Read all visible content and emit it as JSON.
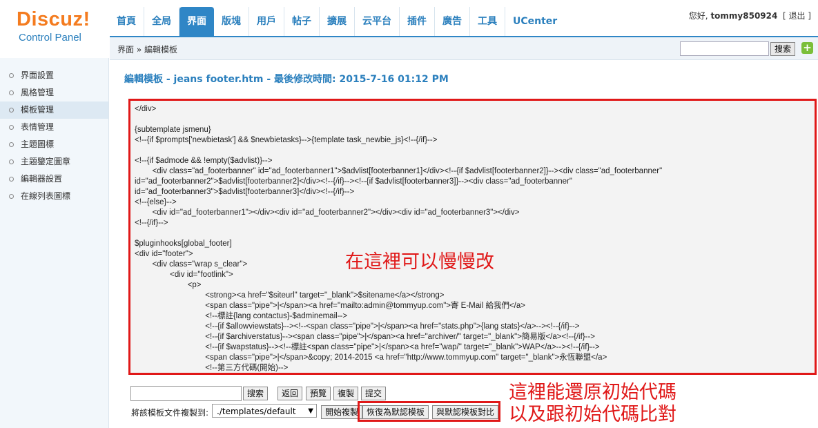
{
  "logo": {
    "main": "Discuz!",
    "sub": "Control Panel"
  },
  "nav": [
    {
      "label": "首頁",
      "active": false
    },
    {
      "label": "全局",
      "active": false
    },
    {
      "label": "界面",
      "active": true
    },
    {
      "label": "版塊",
      "active": false
    },
    {
      "label": "用戶",
      "active": false
    },
    {
      "label": "帖子",
      "active": false
    },
    {
      "label": "擴展",
      "active": false
    },
    {
      "label": "云平台",
      "active": false
    },
    {
      "label": "插件",
      "active": false
    },
    {
      "label": "廣告",
      "active": false
    },
    {
      "label": "工具",
      "active": false
    },
    {
      "label": "UCenter",
      "active": false
    }
  ],
  "user": {
    "greeting": "您好,",
    "name": "tommy850924",
    "logout": "[ 退出 ]"
  },
  "breadcrumb": "界面 » 編輯模板",
  "top_search": {
    "button": "搜索",
    "add": "+"
  },
  "sidebar": [
    {
      "label": "界面設置",
      "active": false
    },
    {
      "label": "風格管理",
      "active": false
    },
    {
      "label": "模板管理",
      "active": true
    },
    {
      "label": "表情管理",
      "active": false
    },
    {
      "label": "主題圖標",
      "active": false
    },
    {
      "label": "主題鑒定圖章",
      "active": false
    },
    {
      "label": "編輯器設置",
      "active": false
    },
    {
      "label": "在線列表圖標",
      "active": false
    }
  ],
  "page_title": "編輯模板 - jeans footer.htm - 最後修改時間: 2015-7-16 01:12 PM",
  "code": "</div>\n\n{subtemplate jsmenu}\n<!--{if $prompts['newbietask'] && $newbietasks}-->{template task_newbie_js}<!--{/if}-->\n\n<!--{if $admode && !empty($advlist)}-->\n        <div class=\"ad_footerbanner\" id=\"ad_footerbanner1\">$advlist[footerbanner1]</div><!--{if $advlist[footerbanner2]}--><div class=\"ad_footerbanner\"\nid=\"ad_footerbanner2\">$advlist[footerbanner2]</div><!--{/if}--><!--{if $advlist[footerbanner3]}--><div class=\"ad_footerbanner\"\nid=\"ad_footerbanner3\">$advlist[footerbanner3]</div><!--{/if}-->\n<!--{else}-->\n        <div id=\"ad_footerbanner1\"></div><div id=\"ad_footerbanner2\"></div><div id=\"ad_footerbanner3\"></div>\n<!--{/if}-->\n\n$pluginhooks[global_footer]\n<div id=\"footer\">\n        <div class=\"wrap s_clear\">\n                <div id=\"footlink\">\n                        <p>\n                                <strong><a href=\"$siteurl\" target=\"_blank\">$sitename</a></strong>\n                                <span class=\"pipe\">|</span><a href=\"mailto:admin@tommyup.com\">寄 E-Mail 給我們</a>\n                                <!--標註{lang contactus}-$adminemail-->\n                                <!--{if $allowviewstats}--><!--<span class=\"pipe\">|</span><a href=\"stats.php\">{lang stats}</a>--><!--{/if}-->\n                                <!--{if $archiverstatus}--><span class=\"pipe\">|</span><a href=\"archiver/\" target=\"_blank\">簡易版</a><!--{/if}-->\n                                <!--{if $wapstatus}--><!--標註<span class=\"pipe\">|</span><a href=\"wap/\" target=\"_blank\">WAP</a>--><!--{/if}-->\n                                <span class=\"pipe\">|</span>&copy; 2014-2015 <a href=\"http://www.tommyup.com\" target=\"_blank\">永恆聯盟</a>\n                                <!--第三方代碼(開始)-->",
  "annotation_editor": "在這裡可以慢慢改",
  "annotation_restore_line1": "這裡能還原初始代碼",
  "annotation_restore_line2": "以及跟初始代碼比對",
  "actions": {
    "search": "搜索",
    "return": "返回",
    "preview": "預覽",
    "copy": "複製",
    "submit": "提交"
  },
  "copy_to": {
    "label": "將該模板文件複製到:",
    "selected": "./templates/default",
    "start": "開始複製",
    "restore": "恢復為默認模板",
    "compare": "與默認模板對比"
  },
  "colors": {
    "accent": "#2f86c6",
    "logo": "#f47c20",
    "annotation": "#e01818"
  }
}
